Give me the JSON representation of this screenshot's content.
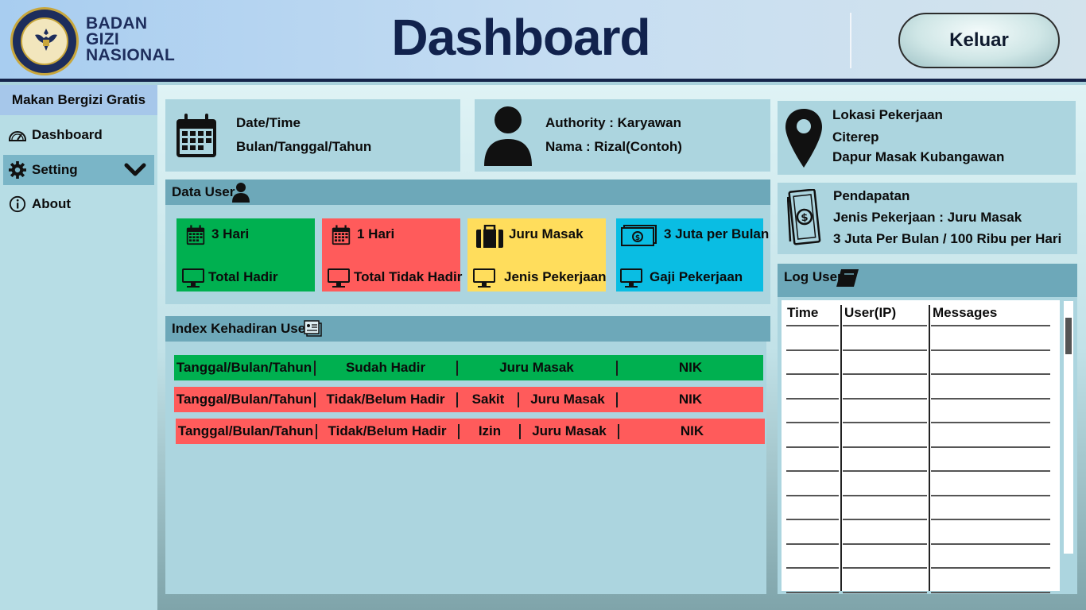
{
  "brand": {
    "line1": "BADAN",
    "line2": "GIZI",
    "line3": "NASIONAL"
  },
  "header": {
    "title": "Dashboard",
    "logout_label": "Keluar"
  },
  "sidebar": {
    "title": "Makan Bergizi Gratis",
    "items": [
      {
        "label": "Dashboard",
        "icon": "gauge-icon"
      },
      {
        "label": "Setting",
        "icon": "gear-icon"
      },
      {
        "label": "About",
        "icon": "info-icon"
      }
    ]
  },
  "datetime_card": {
    "label": "Date/Time",
    "value": "Bulan/Tanggal/Tahun"
  },
  "user_card": {
    "authority": "Authority : Karyawan",
    "name": "Nama : Rizal(Contoh)"
  },
  "location_card": {
    "label": "Lokasi Pekerjaan",
    "city": "Citerep",
    "place": "Dapur Masak Kubangawan"
  },
  "income_card": {
    "label": "Pendapatan",
    "job": "Jenis Pekerjaan : Juru Masak",
    "rate": "3 Juta Per Bulan / 100 Ribu per Hari"
  },
  "data_user": {
    "title": "Data User",
    "tiles": [
      {
        "value": "3 Hari",
        "caption": "Total Hadir",
        "color": "#00b050"
      },
      {
        "value": "1 Hari",
        "caption": "Total Tidak Hadir",
        "color": "#ff5b5b"
      },
      {
        "value": "Juru Masak",
        "caption": "Jenis Pekerjaan",
        "color": "#ffdd5c"
      },
      {
        "value": "3 Juta per Bulan",
        "caption": "Gaji Pekerjaan",
        "color": "#0abde3"
      }
    ]
  },
  "attendance": {
    "title": "Index Kehadiran User",
    "rows": [
      {
        "date": "Tanggal/Bulan/Tahun",
        "status": "Sudah Hadir",
        "reason": "",
        "job": "Juru Masak",
        "id": "NIK",
        "color": "#00b050"
      },
      {
        "date": "Tanggal/Bulan/Tahun",
        "status": "Tidak/Belum Hadir",
        "reason": "Sakit",
        "job": "Juru Masak",
        "id": "NIK",
        "color": "#ff5b5b"
      },
      {
        "date": "Tanggal/Bulan/Tahun",
        "status": "Tidak/Belum Hadir",
        "reason": "Izin",
        "job": "Juru Masak",
        "id": "NIK",
        "color": "#ff5b5b"
      }
    ]
  },
  "log_user": {
    "title": "Log User",
    "columns": [
      "Time",
      "User(IP)",
      "Messages"
    ]
  }
}
